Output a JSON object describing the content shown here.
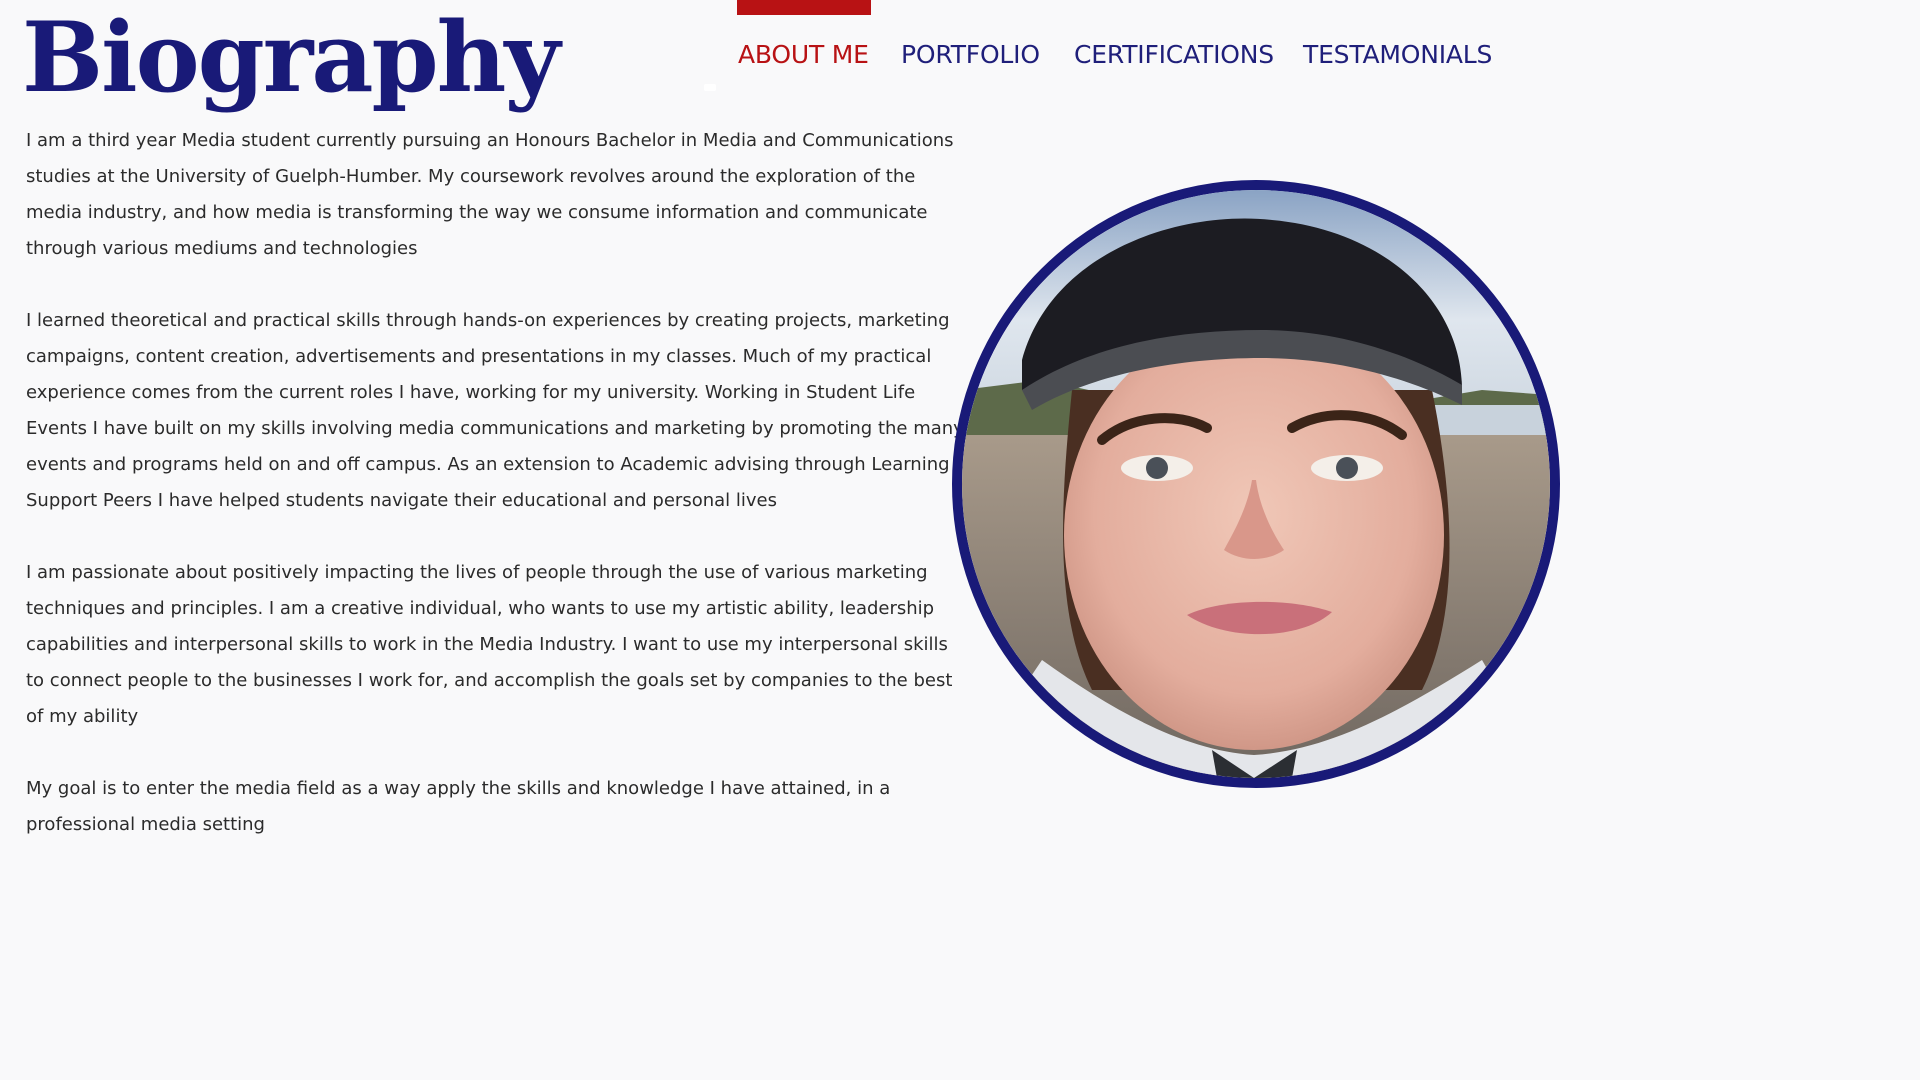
{
  "header": {
    "title": "Biography"
  },
  "nav": {
    "items": [
      {
        "label": "ABOUT ME",
        "active": true
      },
      {
        "label": "PORTFOLIO",
        "active": false
      },
      {
        "label": "CERTIFICATIONS",
        "active": false
      },
      {
        "label": "TESTAMONIALS",
        "active": false
      }
    ]
  },
  "bio": {
    "paragraphs": [
      "I am a third year Media student currently pursuing an Honours Bachelor in Media and Communications studies at the University of Guelph-Humber. My coursework revolves around the exploration of the media industry, and how media is transforming the way we consume information and communicate through various mediums and technologies",
      "I learned theoretical and practical skills through hands-on experiences by creating projects, marketing campaigns, content creation, advertisements and presentations in my classes. Much of my practical experience comes from the current roles I have, working for my university. Working in Student Life Events I have built on my skills involving media communications and marketing by promoting the many events and programs held on and off campus. As an extension to Academic advising through Learning Support Peers I have helped students navigate their educational and personal lives",
      "I am passionate about positively impacting the lives of people through the use of various marketing techniques and principles. I am a creative individual, who wants to use my artistic ability, leadership capabilities and interpersonal skills to work in the Media Industry.  I want to use my interpersonal skills to connect people to the businesses I work for, and accomplish the goals set by companies to the best of my ability",
      "My goal is to enter the media field as a way apply the skills and knowledge I have attained, in a professional media setting"
    ]
  },
  "portrait": {
    "icon": "profile-photo"
  },
  "colors": {
    "background": "#f9f9fa",
    "brand_navy": "#191a78",
    "accent_red": "#b81214",
    "body_text": "#2b2b2b"
  }
}
